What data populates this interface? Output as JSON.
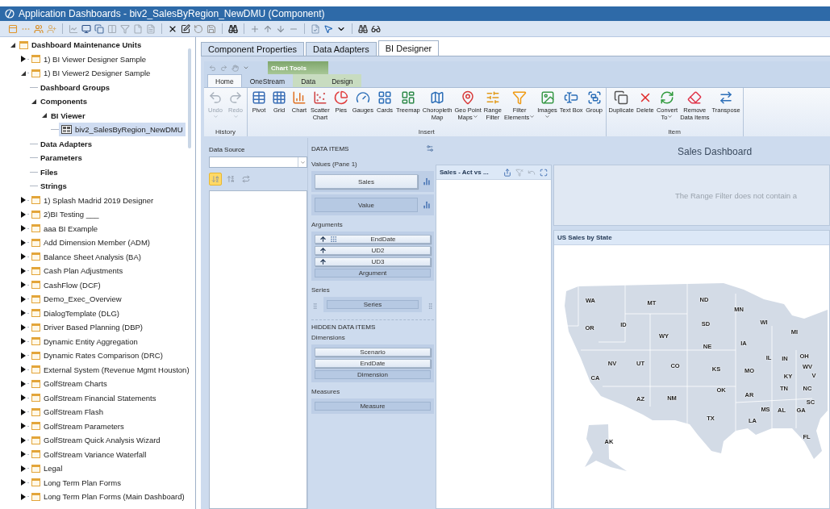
{
  "window": {
    "title": "Application Dashboards - biv2_SalesByRegion_NewDMU (Component)"
  },
  "tree": {
    "items": [
      {
        "label": "Dashboard Maintenance Units",
        "kind": "root",
        "expanded": true,
        "selected": false,
        "children": [
          {
            "label": "1) BI Viewer Designer Sample",
            "kind": "unit",
            "expanded": false,
            "selected": false
          },
          {
            "label": "1) BI Viewer2 Designer Sample",
            "kind": "unit",
            "expanded": true,
            "selected": false,
            "children": [
              {
                "label": "Dashboard Groups",
                "kind": "group",
                "selected": false
              },
              {
                "label": "Components",
                "kind": "group",
                "expanded": true,
                "selected": false,
                "children": [
                  {
                    "label": "BI Viewer",
                    "kind": "group",
                    "expanded": true,
                    "selected": false,
                    "children": [
                      {
                        "label": "biv2_SalesByRegion_NewDMU",
                        "kind": "component",
                        "selected": true
                      }
                    ]
                  }
                ]
              },
              {
                "label": "Data Adapters",
                "kind": "group",
                "selected": false
              },
              {
                "label": "Parameters",
                "kind": "group",
                "selected": false
              },
              {
                "label": "Files",
                "kind": "group",
                "selected": false
              },
              {
                "label": "Strings",
                "kind": "group",
                "selected": false
              }
            ]
          },
          {
            "label": "1) Splash Madrid 2019 Designer",
            "kind": "unit",
            "expanded": false,
            "selected": false
          },
          {
            "label": "2)BI Testing ___",
            "kind": "unit",
            "expanded": false,
            "selected": false
          },
          {
            "label": "aaa BI Example",
            "kind": "unit",
            "expanded": false,
            "selected": false
          },
          {
            "label": "Add Dimension Member (ADM)",
            "kind": "unit",
            "expanded": false,
            "selected": false
          },
          {
            "label": "Balance Sheet Analysis (BA)",
            "kind": "unit",
            "expanded": false,
            "selected": false
          },
          {
            "label": "Cash Plan Adjustments",
            "kind": "unit",
            "expanded": false,
            "selected": false
          },
          {
            "label": "CashFlow (DCF)",
            "kind": "unit",
            "expanded": false,
            "selected": false
          },
          {
            "label": "Demo_Exec_Overview",
            "kind": "unit",
            "expanded": false,
            "selected": false
          },
          {
            "label": "DialogTemplate (DLG)",
            "kind": "unit",
            "expanded": false,
            "selected": false
          },
          {
            "label": "Driver Based Planning (DBP)",
            "kind": "unit",
            "expanded": false,
            "selected": false
          },
          {
            "label": "Dynamic Entity Aggregation",
            "kind": "unit",
            "expanded": false,
            "selected": false
          },
          {
            "label": "Dynamic Rates Comparison (DRC)",
            "kind": "unit",
            "expanded": false,
            "selected": false
          },
          {
            "label": "External System (Revenue Mgmt Houston)",
            "kind": "unit",
            "expanded": false,
            "selected": false
          },
          {
            "label": "GolfStream Charts",
            "kind": "unit",
            "expanded": false,
            "selected": false
          },
          {
            "label": "GolfStream Financial Statements",
            "kind": "unit",
            "expanded": false,
            "selected": false
          },
          {
            "label": "GolfStream Flash",
            "kind": "unit",
            "expanded": false,
            "selected": false
          },
          {
            "label": "GolfStream Parameters",
            "kind": "unit",
            "expanded": false,
            "selected": false
          },
          {
            "label": "GolfStream Quick Analysis Wizard",
            "kind": "unit",
            "expanded": false,
            "selected": false
          },
          {
            "label": "GolfStream Variance Waterfall",
            "kind": "unit",
            "expanded": false,
            "selected": false
          },
          {
            "label": "Legal",
            "kind": "unit",
            "expanded": false,
            "selected": false
          },
          {
            "label": "Long Term Plan Forms",
            "kind": "unit",
            "expanded": false,
            "selected": false
          },
          {
            "label": "Long Term Plan Forms (Main Dashboard)",
            "kind": "unit",
            "expanded": false,
            "selected": false
          }
        ]
      }
    ]
  },
  "tabs": [
    {
      "label": "Component Properties",
      "selected": false
    },
    {
      "label": "Data Adapters",
      "selected": false
    },
    {
      "label": "BI Designer",
      "selected": true
    }
  ],
  "ribbon": {
    "context_group": "Chart Tools",
    "tabs": [
      {
        "label": "Home",
        "selected": true
      },
      {
        "label": "OneStream",
        "selected": false
      },
      {
        "label": "Data",
        "selected": false
      },
      {
        "label": "Design",
        "selected": false
      }
    ],
    "groups": [
      {
        "label": "History",
        "buttons": [
          {
            "label": "Undo",
            "disabled": true,
            "dropdown": true
          },
          {
            "label": "Redo",
            "disabled": true,
            "dropdown": true
          }
        ]
      },
      {
        "label": "Insert",
        "buttons": [
          {
            "label": "Pivot",
            "disabled": false,
            "dropdown": false
          },
          {
            "label": "Grid",
            "disabled": false,
            "dropdown": false
          },
          {
            "label": "Chart",
            "disabled": false,
            "dropdown": false
          },
          {
            "label": "Scatter\nChart",
            "disabled": false,
            "dropdown": false
          },
          {
            "label": "Pies",
            "disabled": false,
            "dropdown": false
          },
          {
            "label": "Gauges",
            "disabled": false,
            "dropdown": false
          },
          {
            "label": "Cards",
            "disabled": false,
            "dropdown": false
          },
          {
            "label": "Treemap",
            "disabled": false,
            "dropdown": false
          },
          {
            "label": "Choropleth\nMap",
            "disabled": false,
            "dropdown": false
          },
          {
            "label": "Geo Point\nMaps",
            "disabled": false,
            "dropdown": true
          },
          {
            "label": "Range\nFilter",
            "disabled": false,
            "dropdown": false
          },
          {
            "label": "Filter\nElements",
            "disabled": false,
            "dropdown": true
          },
          {
            "label": "Images",
            "disabled": false,
            "dropdown": true
          },
          {
            "label": "Text Box",
            "disabled": false,
            "dropdown": false
          },
          {
            "label": "Group",
            "disabled": false,
            "dropdown": false
          }
        ]
      },
      {
        "label": "Item",
        "buttons": [
          {
            "label": "Duplicate",
            "disabled": false,
            "dropdown": false
          },
          {
            "label": "Delete",
            "disabled": false,
            "dropdown": false
          },
          {
            "label": "Convert\nTo",
            "disabled": false,
            "dropdown": true
          },
          {
            "label": "Remove\nData Items",
            "disabled": false,
            "dropdown": false
          },
          {
            "label": "Transpose",
            "disabled": false,
            "dropdown": false
          }
        ]
      }
    ]
  },
  "data_source": {
    "label": "Data Source",
    "view_buttons": [
      {
        "selected": true
      },
      {
        "selected": false
      },
      {
        "selected": false
      }
    ]
  },
  "data_items": {
    "title": "DATA ITEMS",
    "sections": [
      {
        "label": "Values (Pane 1)",
        "kind": "values",
        "items": [
          {
            "label": "Sales",
            "kind": "bound"
          },
          {
            "label": "Value",
            "kind": "placeholder"
          }
        ]
      },
      {
        "label": "Arguments",
        "kind": "arguments",
        "items": [
          {
            "label": "EndDate",
            "kind": "bound"
          },
          {
            "label": "UD2",
            "kind": "bound"
          },
          {
            "label": "UD3",
            "kind": "bound"
          },
          {
            "label": "Argument",
            "kind": "placeholder"
          }
        ]
      },
      {
        "label": "Series",
        "kind": "series",
        "items": [
          {
            "label": "Series",
            "kind": "placeholder"
          }
        ]
      }
    ]
  },
  "hidden_items": {
    "title": "HIDDEN DATA ITEMS",
    "sections": [
      {
        "label": "Dimensions",
        "items": [
          {
            "label": "Scenario",
            "kind": "bound"
          },
          {
            "label": "EndDate",
            "kind": "bound"
          },
          {
            "label": "Dimension",
            "kind": "placeholder"
          }
        ]
      },
      {
        "label": "Measures",
        "items": [
          {
            "label": "Measure",
            "kind": "placeholder"
          }
        ]
      }
    ]
  },
  "dashboard": {
    "title": "Sales Dashboard",
    "chart_panel": {
      "title": "Sales - Act vs ..."
    },
    "range_filter": {
      "message": "The Range Filter does not contain a"
    },
    "map_panel": {
      "title": "US Sales by State",
      "states": [
        "WA",
        "MT",
        "ND",
        "MN",
        "OR",
        "ID",
        "SD",
        "WI",
        "MI",
        "WY",
        "NE",
        "IA",
        "IL",
        "IN",
        "OH",
        "NV",
        "UT",
        "CO",
        "KS",
        "MO",
        "CA",
        "KY",
        "WV",
        "V",
        "TN",
        "OK",
        "AR",
        "NC",
        "SC",
        "AZ",
        "NM",
        "MS",
        "AL",
        "GA",
        "TX",
        "LA",
        "FL",
        "AK"
      ]
    }
  }
}
